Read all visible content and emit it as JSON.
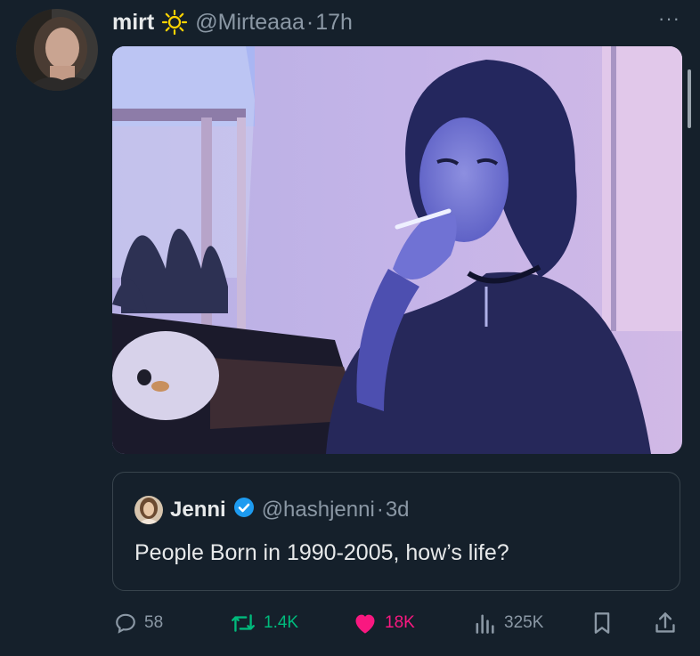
{
  "tweet": {
    "display_name": "mirt",
    "handle": "@Mirteaaa",
    "separator": "·",
    "time": "17h",
    "more_label": "···"
  },
  "quote": {
    "display_name": "Jenni",
    "handle": "@hashjenni",
    "separator": "·",
    "time": "3d",
    "text": "People Born in 1990-2005, how’s life?"
  },
  "actions": {
    "replies": "58",
    "reposts": "1.4K",
    "likes": "18K",
    "views": "325K"
  },
  "colors": {
    "background": "#15202b",
    "muted": "#8b98a5",
    "repost": "#00ba7c",
    "like": "#f91880",
    "verified": "#1d9bf0",
    "sun": "#ffd400"
  },
  "icons": [
    "sun-icon",
    "verified-badge-icon",
    "reply-icon",
    "repost-icon",
    "heart-icon",
    "views-icon",
    "bookmark-icon",
    "share-icon"
  ]
}
